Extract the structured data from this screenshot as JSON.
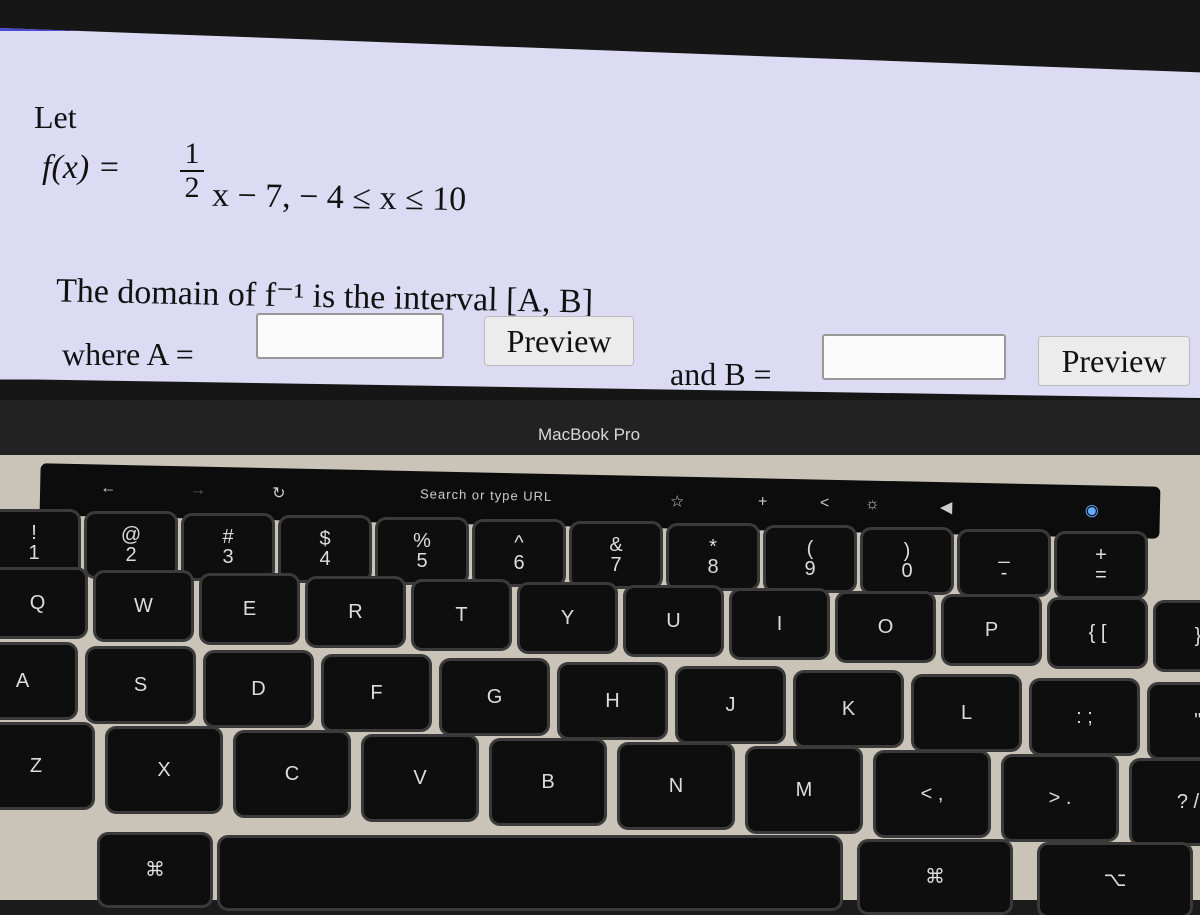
{
  "problem": {
    "let": "Let",
    "fx": "f(x) =",
    "frac_num": "1",
    "frac_den": "2",
    "rest": "x − 7,   − 4 ≤ x ≤ 10",
    "domain_text": "The domain of f⁻¹ is the interval [A, B]",
    "where_a": "where A =",
    "and_b": "and B =",
    "a_value": "",
    "b_value": "",
    "preview_a": "Preview",
    "preview_b": "Preview"
  },
  "laptop": {
    "brand": "MacBook Pro"
  },
  "touchbar": {
    "back": "←",
    "forward": "→",
    "reload": "↻",
    "search": "Search or type URL",
    "bookmark": "☆",
    "new_tab": "+",
    "brightness_less": "<",
    "brightness": "☼",
    "volume": "◀",
    "siri": "◉"
  },
  "keys": {
    "row1": [
      [
        "!",
        "1"
      ],
      [
        "@",
        "2"
      ],
      [
        "#",
        "3"
      ],
      [
        "$",
        "4"
      ],
      [
        "%",
        "5"
      ],
      [
        "^",
        "6"
      ],
      [
        "&",
        "7"
      ],
      [
        "*",
        "8"
      ],
      [
        "(",
        "9"
      ],
      [
        ")",
        "0"
      ],
      [
        "_",
        "-"
      ],
      [
        "+",
        "="
      ]
    ],
    "row2": [
      "Q",
      "W",
      "E",
      "R",
      "T",
      "Y",
      "U",
      "I",
      "O",
      "P",
      "{ [",
      "} ]"
    ],
    "row3": [
      "A",
      "S",
      "D",
      "F",
      "G",
      "H",
      "J",
      "K",
      "L",
      ": ;",
      "\" '"
    ],
    "row4": [
      "Z",
      "X",
      "C",
      "V",
      "B",
      "N",
      "M",
      "< ,",
      "> .",
      "? /"
    ],
    "row5": [
      "⌘",
      "",
      "⌘",
      "⌥"
    ]
  }
}
